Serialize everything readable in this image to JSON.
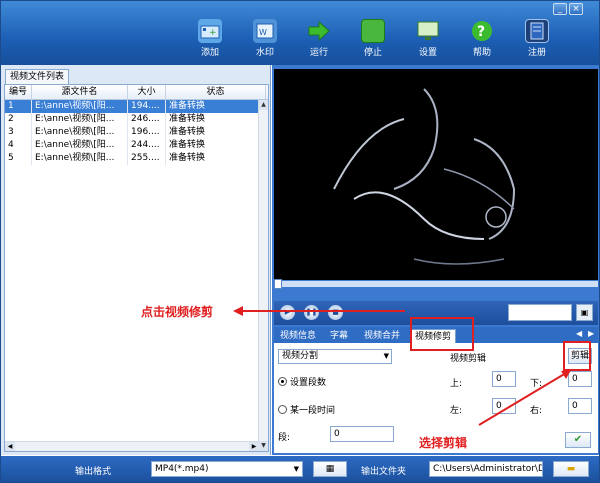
{
  "toolbar": {
    "buttons": [
      {
        "label": "添加",
        "icon": "add-film-icon"
      },
      {
        "label": "水印",
        "icon": "watermark-icon"
      },
      {
        "label": "运行",
        "icon": "run-arrow-icon"
      },
      {
        "label": "停止",
        "icon": "stop-icon"
      },
      {
        "label": "设置",
        "icon": "settings-monitor-icon"
      },
      {
        "label": "帮助",
        "icon": "help-icon"
      },
      {
        "label": "注册",
        "icon": "register-icon"
      }
    ]
  },
  "file_list": {
    "tab_label": "视频文件列表",
    "columns": [
      "编号",
      "源文件名",
      "大小",
      "状态"
    ],
    "rows": [
      {
        "no": "1",
        "name": "E:\\anne\\视频\\[阳...",
        "size": "194....",
        "status": "准备转换"
      },
      {
        "no": "2",
        "name": "E:\\anne\\视频\\[阳...",
        "size": "246....",
        "status": "准备转换"
      },
      {
        "no": "3",
        "name": "E:\\anne\\视频\\[阳...",
        "size": "196....",
        "status": "准备转换"
      },
      {
        "no": "4",
        "name": "E:\\anne\\视频\\[阳...",
        "size": "244....",
        "status": "准备转换"
      },
      {
        "no": "5",
        "name": "E:\\anne\\视频\\[阳...",
        "size": "255....",
        "status": "准备转换"
      }
    ]
  },
  "tabs": [
    "视频信息",
    "字幕",
    "视频合并",
    "视频修剪"
  ],
  "trim": {
    "mode_select": "视频分割",
    "section_title": "视频剪辑",
    "cut_button": "剪辑",
    "radio_segments": "设置段数",
    "radio_time": "某一段时间",
    "segments_label": "段:",
    "segments_value": "0",
    "top_label": "上:",
    "top_value": "0",
    "bottom_label": "下:",
    "bottom_value": "0",
    "left_label": "左:",
    "left_value": "0",
    "right_label": "右:",
    "right_value": "0"
  },
  "annotations": {
    "click_trim": "点击视频修剪",
    "select_cut": "选择剪辑"
  },
  "bottom": {
    "format_label": "输出格式",
    "format_value": "MP4(*.mp4)",
    "folder_label": "输出文件夹",
    "folder_value": "C:\\Users\\Administrator\\Des"
  },
  "colors": {
    "accent_red": "#e02020",
    "header_blue": "#1c5fb4",
    "selection_blue": "#3a7fd6"
  }
}
